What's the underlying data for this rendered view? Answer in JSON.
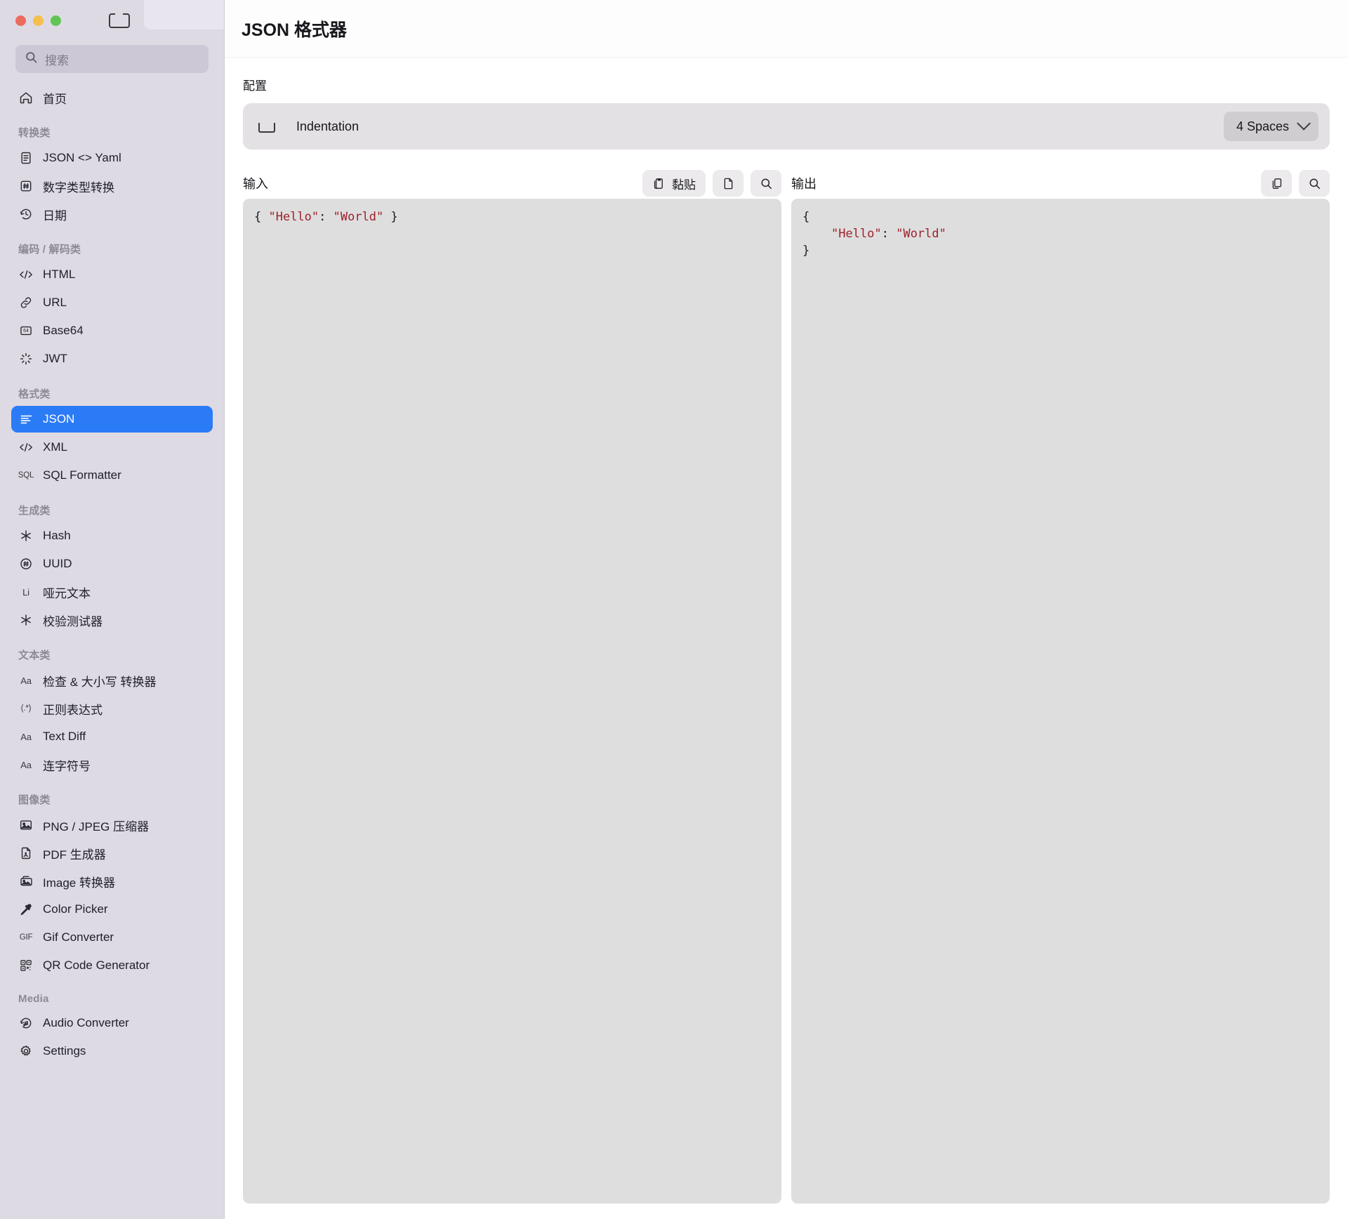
{
  "window": {
    "traffic_lights": [
      "close",
      "minimize",
      "zoom"
    ],
    "sidebar_toggle_icon": "sidebar-toggle-icon"
  },
  "sidebar": {
    "search": {
      "placeholder": "搜索",
      "value": "",
      "icon": "search-icon"
    },
    "home": {
      "label": "首页",
      "icon": "home-icon"
    },
    "sections": [
      {
        "label": "转换类",
        "items": [
          {
            "label": "JSON <> Yaml",
            "icon": "document-lines-icon",
            "active": false
          },
          {
            "label": "数字类型转换",
            "icon": "hash-box-icon",
            "active": false
          },
          {
            "label": "日期",
            "icon": "clock-history-icon",
            "active": false
          }
        ]
      },
      {
        "label": "编码 / 解码类",
        "items": [
          {
            "label": "HTML",
            "icon": "code-brackets-icon",
            "active": false
          },
          {
            "label": "URL",
            "icon": "link-icon",
            "active": false
          },
          {
            "label": "Base64",
            "icon": "base64-box-icon",
            "active": false
          },
          {
            "label": "JWT",
            "icon": "spinner-icon",
            "active": false
          }
        ]
      },
      {
        "label": "格式类",
        "items": [
          {
            "label": "JSON",
            "icon": "align-left-icon",
            "active": true
          },
          {
            "label": "XML",
            "icon": "code-brackets-icon",
            "active": false
          },
          {
            "label": "SQL Formatter",
            "icon": "sql-text-icon",
            "active": false
          }
        ]
      },
      {
        "label": "生成类",
        "items": [
          {
            "label": "Hash",
            "icon": "asterisk-icon",
            "active": false
          },
          {
            "label": "UUID",
            "icon": "hash-circle-icon",
            "active": false
          },
          {
            "label": "哑元文本",
            "icon": "lorem-text-icon",
            "active": false
          },
          {
            "label": "校验测试器",
            "icon": "asterisk-icon",
            "active": false
          }
        ]
      },
      {
        "label": "文本类",
        "items": [
          {
            "label": "检查 & 大小写 转换器",
            "icon": "aa-text-icon",
            "active": false
          },
          {
            "label": "正则表达式",
            "icon": "regex-text-icon",
            "active": false
          },
          {
            "label": "Text Diff",
            "icon": "aa-text-icon",
            "active": false
          },
          {
            "label": "连字符号",
            "icon": "aa-text-icon",
            "active": false
          }
        ]
      },
      {
        "label": "图像类",
        "items": [
          {
            "label": "PNG / JPEG 压缩器",
            "icon": "image-icon",
            "active": false
          },
          {
            "label": "PDF 生成器",
            "icon": "file-pdf-icon",
            "active": false
          },
          {
            "label": "Image 转换器",
            "icon": "images-stack-icon",
            "active": false
          },
          {
            "label": "Color Picker",
            "icon": "eyedropper-icon",
            "active": false
          },
          {
            "label": "Gif Converter",
            "icon": "gif-text-icon",
            "active": false
          },
          {
            "label": "QR Code Generator",
            "icon": "qr-code-icon",
            "active": false
          }
        ]
      },
      {
        "label": "Media",
        "items": [
          {
            "label": "Audio Converter",
            "icon": "audio-convert-icon",
            "active": false
          },
          {
            "label": "Settings",
            "icon": "gear-icon",
            "active": false
          }
        ]
      }
    ]
  },
  "header": {
    "title": "JSON 格式器"
  },
  "config": {
    "label": "配置",
    "indentation": {
      "name": "Indentation",
      "icon": "indent-icon",
      "selected": "4 Spaces",
      "chevron": "chevron-down-icon"
    }
  },
  "input_pane": {
    "title": "输入",
    "buttons": [
      {
        "label": "黏贴",
        "icon": "clipboard-paste-icon"
      },
      {
        "label": "",
        "icon": "file-icon"
      },
      {
        "label": "",
        "icon": "search-icon"
      }
    ],
    "content_prefix": "{ ",
    "content_key": "\"Hello\"",
    "content_colon": ": ",
    "content_value": "\"World\"",
    "content_suffix": " }"
  },
  "output_pane": {
    "title": "输出",
    "buttons": [
      {
        "label": "",
        "icon": "copy-icon"
      },
      {
        "label": "",
        "icon": "search-icon"
      }
    ],
    "line_open": "{",
    "content_indent": "    ",
    "content_key": "\"Hello\"",
    "content_colon": ": ",
    "content_value": "\"World\"",
    "line_close": "}"
  },
  "colors": {
    "accent": "#2b7bf6",
    "sidebar_bg": "#dedae3",
    "editor_bg": "#dfdedf",
    "string_color": "#9c2229"
  }
}
